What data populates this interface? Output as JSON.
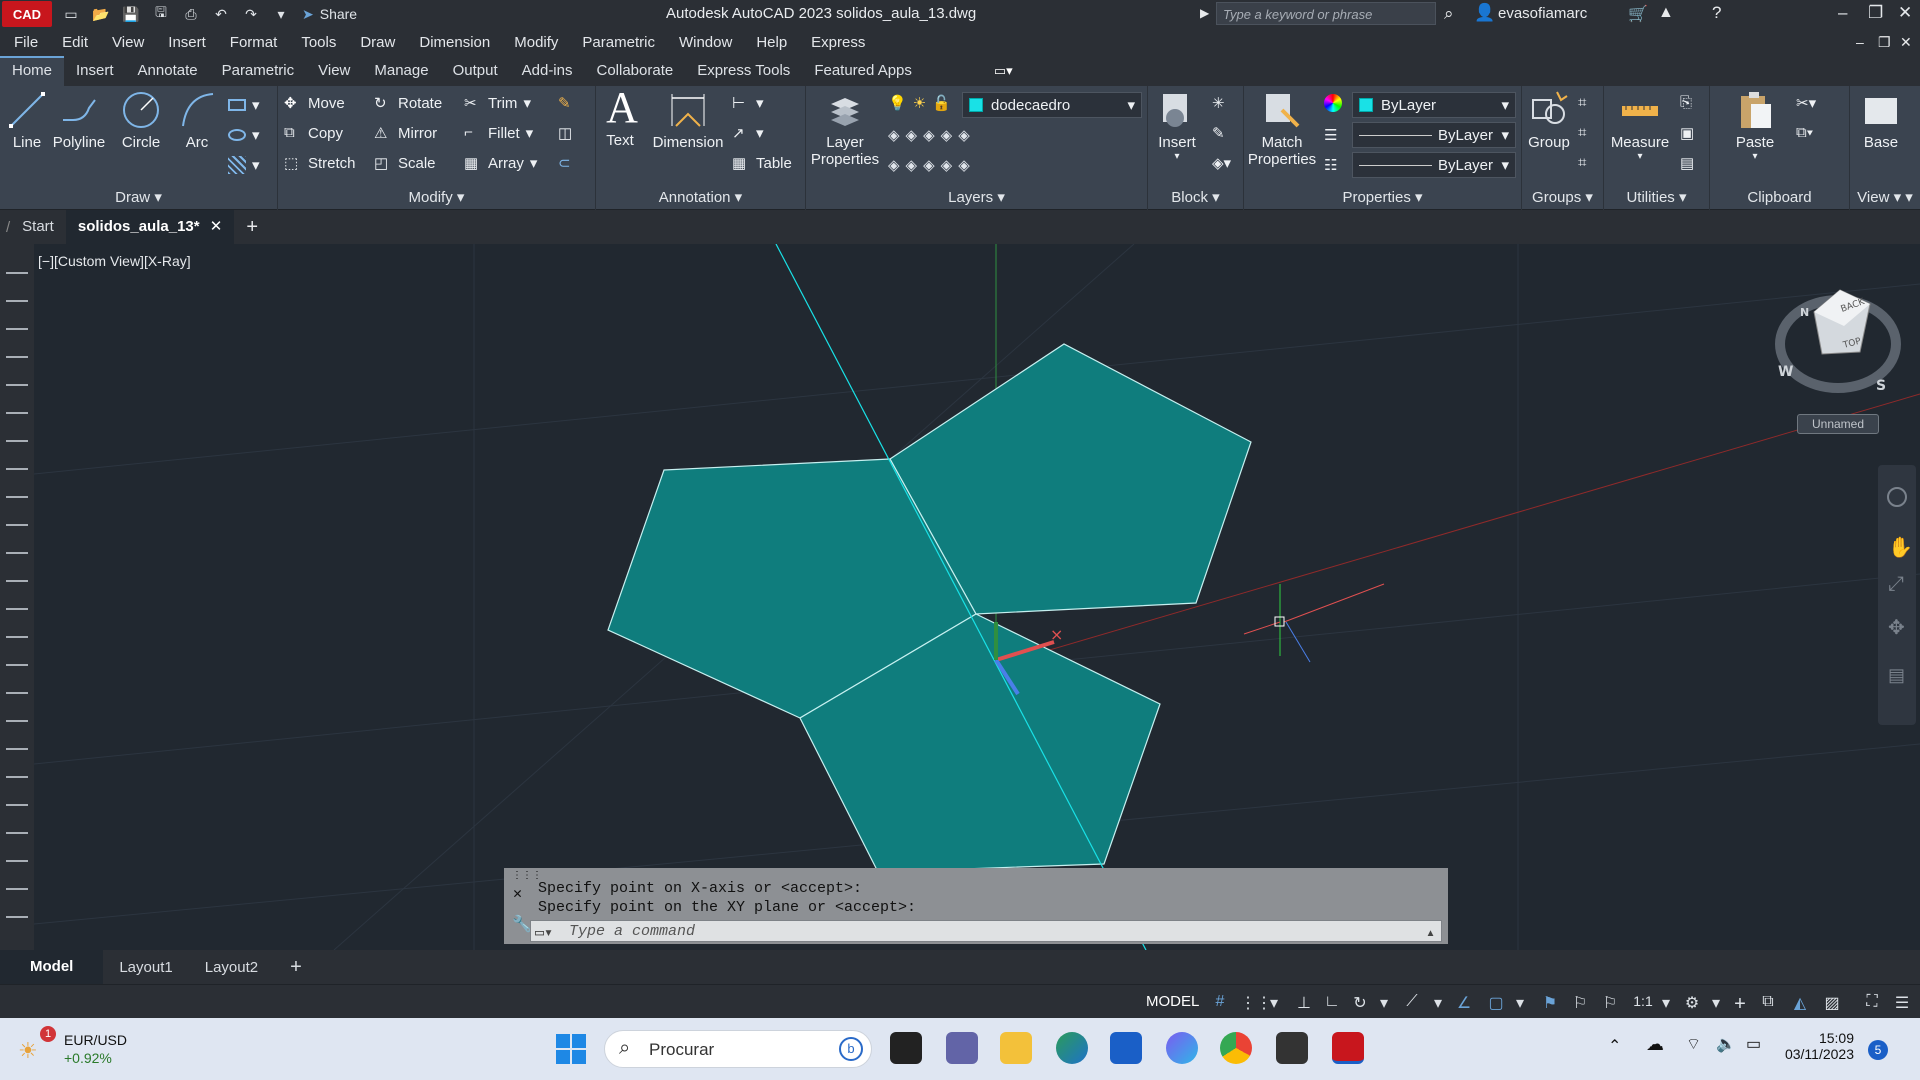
{
  "window": {
    "logo_text": "CAD",
    "share_label": "Share",
    "title": "Autodesk AutoCAD 2023   solidos_aula_13.dwg",
    "search_placeholder": "Type a keyword or phrase",
    "user": "evasofiamarc"
  },
  "menu": [
    "File",
    "Edit",
    "View",
    "Insert",
    "Format",
    "Tools",
    "Draw",
    "Dimension",
    "Modify",
    "Parametric",
    "Window",
    "Help",
    "Express"
  ],
  "ribbon_tabs": [
    "Home",
    "Insert",
    "Annotate",
    "Parametric",
    "View",
    "Manage",
    "Output",
    "Add-ins",
    "Collaborate",
    "Express Tools",
    "Featured Apps"
  ],
  "panels": {
    "draw": {
      "title": "Draw",
      "line": "Line",
      "polyline": "Polyline",
      "circle": "Circle",
      "arc": "Arc"
    },
    "modify": {
      "title": "Modify",
      "move": "Move",
      "rotate": "Rotate",
      "trim": "Trim",
      "copy": "Copy",
      "mirror": "Mirror",
      "fillet": "Fillet",
      "stretch": "Stretch",
      "scale": "Scale",
      "array": "Array"
    },
    "annotation": {
      "title": "Annotation",
      "text": "Text",
      "dimension": "Dimension",
      "table": "Table"
    },
    "layers": {
      "title": "Layers",
      "layer_properties_1": "Layer",
      "layer_properties_2": "Properties",
      "current_layer": "dodecaedro"
    },
    "block": {
      "title": "Block",
      "insert": "Insert"
    },
    "properties": {
      "title": "Properties",
      "match_1": "Match",
      "match_2": "Properties",
      "color": "ByLayer",
      "linetype": "ByLayer",
      "lineweight": "ByLayer"
    },
    "groups": {
      "title": "Groups",
      "group": "Group"
    },
    "utilities": {
      "title": "Utilities",
      "measure": "Measure"
    },
    "clipboard": {
      "title": "Clipboard",
      "paste": "Paste"
    },
    "view": {
      "title": "View",
      "base": "Base"
    }
  },
  "doc_tabs": {
    "start": "Start",
    "active": "solidos_aula_13*"
  },
  "viewport": {
    "label": "[−][Custom View][X-Ray]",
    "viewcube_back": "BACK",
    "viewcube_top": "TOP",
    "compass_w": "W",
    "compass_s": "S",
    "compass_n": "N",
    "named_view": "Unnamed"
  },
  "command": {
    "line1": "Specify point on X-axis or <accept>:",
    "line2": "Specify point on the XY plane or <accept>:",
    "placeholder": "Type a command"
  },
  "layout_tabs": [
    "Model",
    "Layout1",
    "Layout2"
  ],
  "status": {
    "model": "MODEL",
    "scale": "1:1"
  },
  "taskbar": {
    "ticker": "EUR/USD",
    "ticker_change": "+0.92%",
    "badge": "1",
    "search": "Procurar",
    "time": "15:09",
    "date": "03/11/2023",
    "notifications": "5"
  },
  "colors": {
    "accent": "#19e1e6",
    "face_fill": "#0f7d7d",
    "app_red": "#c8161d"
  }
}
